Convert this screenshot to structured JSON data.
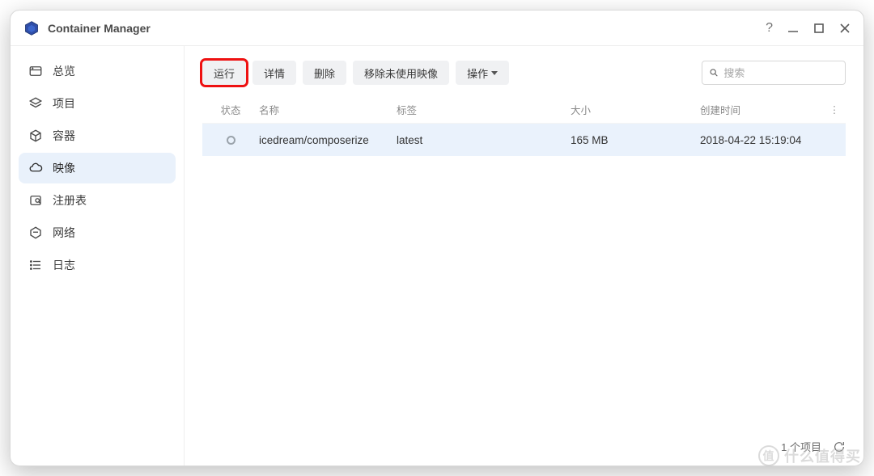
{
  "app": {
    "title": "Container Manager"
  },
  "sidebar": {
    "items": [
      {
        "label": "总览"
      },
      {
        "label": "项目"
      },
      {
        "label": "容器"
      },
      {
        "label": "映像"
      },
      {
        "label": "注册表"
      },
      {
        "label": "网络"
      },
      {
        "label": "日志"
      }
    ]
  },
  "toolbar": {
    "run": "运行",
    "details": "详情",
    "delete": "删除",
    "remove_unused": "移除未使用映像",
    "actions": "操作"
  },
  "search": {
    "placeholder": "搜索"
  },
  "columns": {
    "status": "状态",
    "name": "名称",
    "tag": "标签",
    "size": "大小",
    "created": "创建时间"
  },
  "rows": [
    {
      "name": "icedream/composerize",
      "tag": "latest",
      "size": "165 MB",
      "created": "2018-04-22 15:19:04"
    }
  ],
  "footer": {
    "count_label": "1 个项目"
  },
  "watermark": {
    "badge": "值",
    "text": "什么值得买"
  }
}
